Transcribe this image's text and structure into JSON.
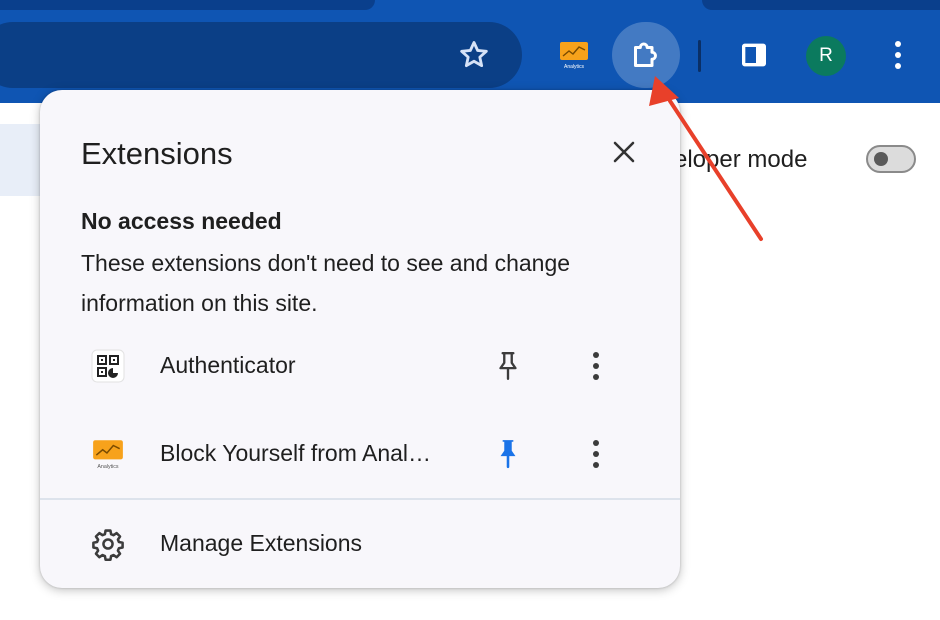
{
  "browser": {
    "avatar_letter": "R",
    "analytics_icon_text": "Analytics",
    "colors": {
      "toolbar": "#0f55b3",
      "avatar": "#0b7a5e",
      "pin_active": "#1a73e8",
      "annotation_arrow": "#e8402a"
    }
  },
  "page": {
    "developer_mode_label": "veloper mode",
    "developer_mode_on": false
  },
  "popup": {
    "title": "Extensions",
    "section_heading": "No access needed",
    "section_description": "These extensions don't need to see and change information on this site.",
    "extensions": [
      {
        "name": "Authenticator",
        "icon": "qr-code-icon",
        "pinned": false
      },
      {
        "name": "Block Yourself from Anal…",
        "icon": "analytics-icon",
        "icon_text": "Analytics",
        "pinned": true
      }
    ],
    "manage_label": "Manage Extensions"
  }
}
